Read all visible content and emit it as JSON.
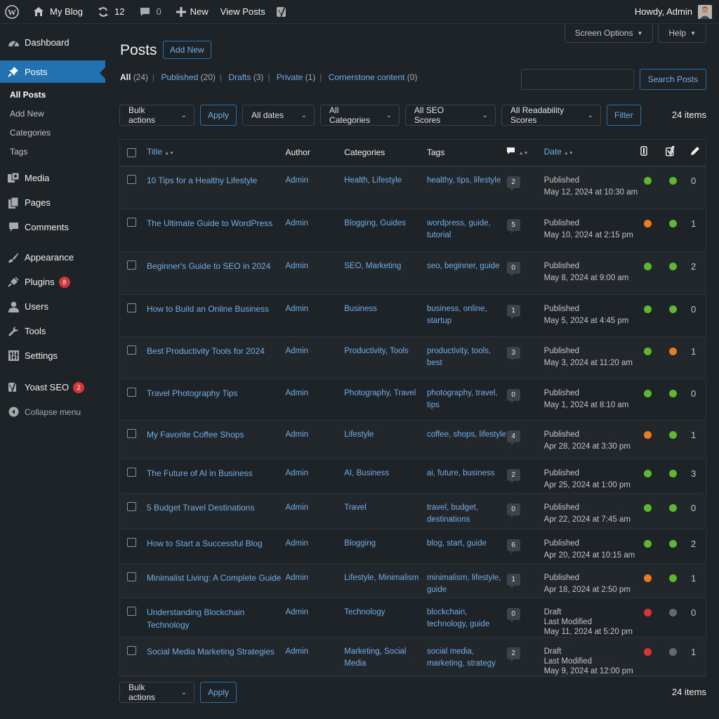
{
  "adminbar": {
    "site_name": "My Blog",
    "updates_count": "12",
    "comments_count": "0",
    "new_label": "New",
    "view_posts_label": "View Posts",
    "howdy": "Howdy, Admin"
  },
  "sidebar": {
    "dashboard": "Dashboard",
    "posts": "Posts",
    "sub": [
      "All Posts",
      "Add New",
      "Categories",
      "Tags"
    ],
    "media": "Media",
    "pages": "Pages",
    "comments": "Comments",
    "appearance": "Appearance",
    "plugins": "Plugins",
    "plugins_badge": "8",
    "users": "Users",
    "tools": "Tools",
    "settings": "Settings",
    "yoast": "Yoast SEO",
    "yoast_badge": "2",
    "collapse": "Collapse menu"
  },
  "screen_meta": {
    "screen_options": "Screen Options",
    "help": "Help"
  },
  "page": {
    "title": "Posts",
    "add_new": "Add New",
    "filters": {
      "all": "All",
      "all_count": "(24)",
      "published": "Published",
      "published_count": "(20)",
      "drafts": "Drafts",
      "drafts_count": "(3)",
      "private": "Private",
      "private_count": "(1)",
      "cornerstone": "Cornerstone content",
      "cornerstone_count": "(0)"
    },
    "search_button": "Search Posts",
    "bulk_actions": "Bulk actions",
    "apply": "Apply",
    "all_dates": "All dates",
    "all_categories": "All Categories",
    "all_seo": "All SEO Scores",
    "all_readability": "All Readability Scores",
    "filter": "Filter",
    "items_count": "24 items"
  },
  "table": {
    "headers": {
      "title": "Title",
      "author": "Author",
      "categories": "Categories",
      "tags": "Tags",
      "date": "Date"
    },
    "colors": {
      "good": "#5eb82c",
      "ok": "#ee7c1b",
      "bad": "#dc3232",
      "na": "#646970"
    },
    "rows": [
      {
        "title": "10 Tips for a Healthy Lifestyle",
        "author": "Admin",
        "cats": "Health, Lifestyle",
        "tags": "healthy, tips, lifestyle",
        "comments": "2",
        "status": "Published",
        "modified": "",
        "date": "May 12, 2024 at 10:30 am",
        "seo": "good",
        "read": "good",
        "links": "0",
        "h": 61
      },
      {
        "title": "The Ultimate Guide to WordPress",
        "author": "Admin",
        "cats": "Blogging, Guides",
        "tags": "wordpress, guide, tutorial",
        "comments": "5",
        "status": "Published",
        "modified": "",
        "date": "May 10, 2024 at 2:15 pm",
        "seo": "ok",
        "read": "good",
        "links": "1",
        "h": 61
      },
      {
        "title": "Beginner's Guide to SEO in 2024",
        "author": "Admin",
        "cats": "SEO, Marketing",
        "tags": "seo, beginner, guide",
        "comments": "0",
        "status": "Published",
        "modified": "",
        "date": "May 8, 2024 at 9:00 am",
        "seo": "good",
        "read": "good",
        "links": "2",
        "h": 61
      },
      {
        "title": "How to Build an Online Business",
        "author": "Admin",
        "cats": "Business",
        "tags": "business, online, startup",
        "comments": "1",
        "status": "Published",
        "modified": "",
        "date": "May 5, 2024 at 4:45 pm",
        "seo": "good",
        "read": "good",
        "links": "0",
        "h": 60
      },
      {
        "title": "Best Productivity Tools for 2024",
        "author": "Admin",
        "cats": "Productivity, Tools",
        "tags": "productivity, tools, best",
        "comments": "3",
        "status": "Published",
        "modified": "",
        "date": "May 3, 2024 at 11:20 am",
        "seo": "good",
        "read": "ok",
        "links": "1",
        "h": 60
      },
      {
        "title": "Travel Photography Tips",
        "author": "Admin",
        "cats": "Photography, Travel",
        "tags": "photography, travel, tips",
        "comments": "0",
        "status": "Published",
        "modified": "",
        "date": "May 1, 2024 at 8:10 am",
        "seo": "good",
        "read": "good",
        "links": "0",
        "h": 59
      },
      {
        "title": "My Favorite Coffee Shops",
        "author": "Admin",
        "cats": "Lifestyle",
        "tags": "coffee, shops, lifestyle",
        "comments": "4",
        "status": "Published",
        "modified": "",
        "date": "Apr 28, 2024 at 3:30 pm",
        "seo": "ok",
        "read": "good",
        "links": "1",
        "h": 55
      },
      {
        "title": "The Future of AI in Business",
        "author": "Admin",
        "cats": "AI, Business",
        "tags": "ai, future, business",
        "comments": "2",
        "status": "Published",
        "modified": "",
        "date": "Apr 25, 2024 at 1:00 pm",
        "seo": "good",
        "read": "good",
        "links": "3",
        "h": 49
      },
      {
        "title": "5 Budget Travel Destinations",
        "author": "Admin",
        "cats": "Travel",
        "tags": "travel, budget, destinations",
        "comments": "0",
        "status": "Published",
        "modified": "",
        "date": "Apr 22, 2024 at 7:45 am",
        "seo": "good",
        "read": "good",
        "links": "0",
        "h": 51
      },
      {
        "title": "How to Start a Successful Blog",
        "author": "Admin",
        "cats": "Blogging",
        "tags": "blog, start, guide",
        "comments": "6",
        "status": "Published",
        "modified": "",
        "date": "Apr 20, 2024 at 10:15 am",
        "seo": "good",
        "read": "good",
        "links": "2",
        "h": 49
      },
      {
        "title": "Minimalist Living: A Complete Guide",
        "author": "Admin",
        "cats": "Lifestyle, Minimalism",
        "tags": "minimalism, lifestyle, guide",
        "comments": "1",
        "status": "Published",
        "modified": "",
        "date": "Apr 18, 2024 at 2:50 pm",
        "seo": "ok",
        "read": "good",
        "links": "1",
        "h": 49
      },
      {
        "title": "Understanding Blockchain Technology",
        "author": "Admin",
        "cats": "Technology",
        "tags": "blockchain, technology, guide",
        "comments": "0",
        "status": "Draft",
        "modified": "Last Modified",
        "date": "May 11, 2024 at 5:20 pm",
        "seo": "bad",
        "read": "na",
        "links": "0",
        "h": 56
      },
      {
        "title": "Social Media Marketing Strategies",
        "author": "Admin",
        "cats": "Marketing, Social Media",
        "tags": "social media, marketing, strategy",
        "comments": "2",
        "status": "Draft",
        "modified": "Last Modified",
        "date": "May 9, 2024 at 12:00 pm",
        "seo": "bad",
        "read": "na",
        "links": "1",
        "h": 55
      }
    ]
  }
}
